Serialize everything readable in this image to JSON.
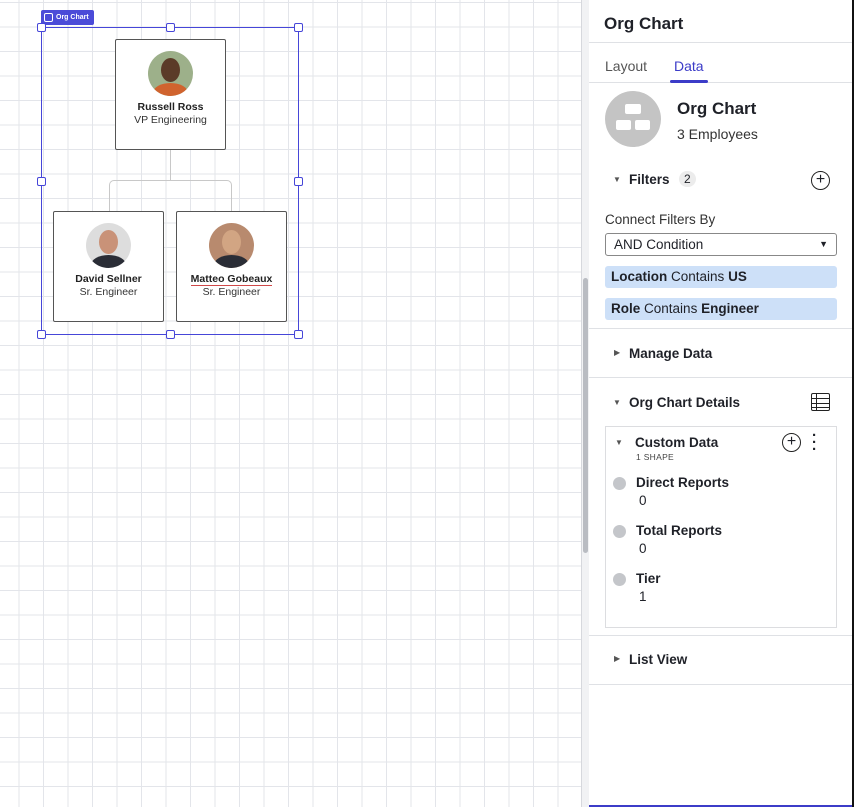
{
  "canvas": {
    "badge_label": "Org Chart",
    "nodes": [
      {
        "name": "Russell Ross",
        "role": "VP Engineering"
      },
      {
        "name": "David Sellner",
        "role": "Sr. Engineer"
      },
      {
        "name": "Matteo Gobeaux",
        "role": "Sr. Engineer"
      }
    ]
  },
  "panel": {
    "title": "Org Chart",
    "tabs": [
      {
        "label": "Layout",
        "active": false
      },
      {
        "label": "Data",
        "active": true
      }
    ],
    "summary": {
      "title": "Org Chart",
      "subtitle": "3 Employees"
    },
    "filters": {
      "label": "Filters",
      "count": "2",
      "connect_label": "Connect Filters By",
      "connect_value": "AND Condition",
      "items": [
        {
          "field": "Location",
          "op": "Contains",
          "value": "US"
        },
        {
          "field": "Role",
          "op": "Contains",
          "value": "Engineer"
        }
      ]
    },
    "manage_data": "Manage Data",
    "details": {
      "label": "Org Chart Details",
      "custom": {
        "title": "Custom Data",
        "sub": "1 SHAPE",
        "fields": [
          {
            "label": "Direct Reports",
            "value": "0"
          },
          {
            "label": "Total Reports",
            "value": "0"
          },
          {
            "label": "Tier",
            "value": "1"
          }
        ]
      }
    },
    "list_view": "List View"
  },
  "colors": {
    "accent": "#3c3cc8",
    "chip": "#cde0f8",
    "selection": "#4646d8"
  }
}
